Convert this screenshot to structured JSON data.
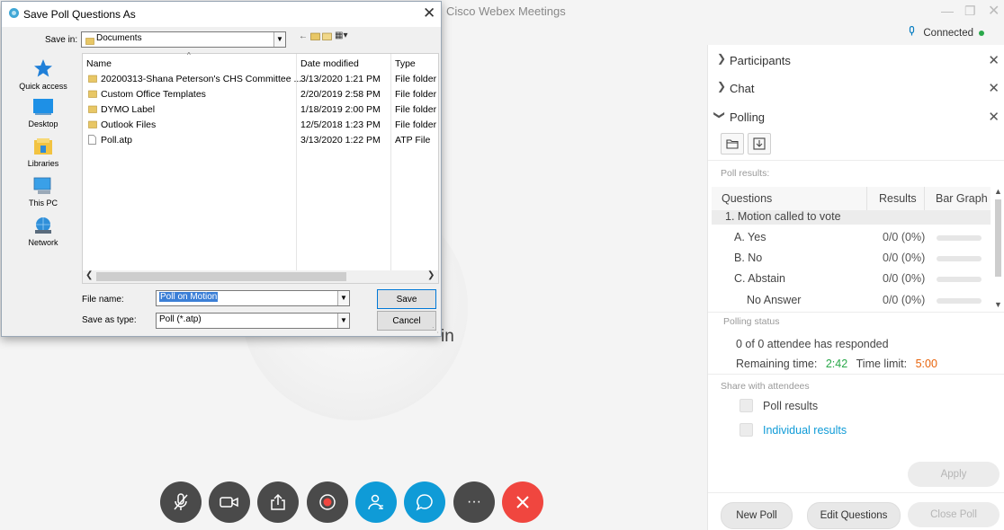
{
  "app": {
    "title": "Cisco Webex Meetings",
    "status": "Connected"
  },
  "meeting": {
    "name_fragment": "in",
    "controls": [
      "mute",
      "video",
      "share",
      "record",
      "participants",
      "chat",
      "more",
      "leave"
    ],
    "more_label": "···"
  },
  "panel": {
    "sections": {
      "participants": "Participants",
      "chat": "Chat",
      "polling": "Polling"
    },
    "poll_results_label": "Poll results:",
    "table": {
      "col_questions": "Questions",
      "col_results": "Results",
      "col_bar": "Bar Graph",
      "question": "1.  Motion called to vote",
      "answers": [
        {
          "label": "A.   Yes",
          "result": "0/0 (0%)",
          "fill": 0
        },
        {
          "label": "B.   No",
          "result": "0/0 (0%)",
          "fill": 0
        },
        {
          "label": "C.   Abstain",
          "result": "0/0 (0%)",
          "fill": 0
        },
        {
          "label": "No Answer",
          "result": "0/0 (0%)",
          "fill": 0
        }
      ]
    },
    "polling_status_label": "Polling status",
    "responded": "0   of   0   attendee has responded",
    "remaining_label": "Remaining time:",
    "remaining_value": "2:42",
    "limit_label": "Time limit:",
    "limit_value": "5:00",
    "share_label": "Share with attendees",
    "share_poll_results": "Poll results",
    "share_individual": "Individual results",
    "apply": "Apply",
    "new_poll": "New Poll",
    "edit_questions": "Edit Questions",
    "close_poll": "Close Poll",
    "colors": {
      "accent": "#0f9bd7",
      "remaining": "#2aa84a",
      "limit": "#e8630a",
      "leave": "#f0463f"
    }
  },
  "dialog": {
    "title": "Save Poll Questions As",
    "save_in_label": "Save in:",
    "save_in_value": "Documents",
    "places": [
      "Quick access",
      "Desktop",
      "Libraries",
      "This PC",
      "Network"
    ],
    "columns": {
      "name": "Name",
      "date": "Date modified",
      "type": "Type"
    },
    "files": [
      {
        "name": "20200313-Shana Peterson's CHS Committee ...",
        "date": "3/13/2020 1:21 PM",
        "type": "File folder",
        "kind": "folder"
      },
      {
        "name": "Custom Office Templates",
        "date": "2/20/2019 2:58 PM",
        "type": "File folder",
        "kind": "folder"
      },
      {
        "name": "DYMO Label",
        "date": "1/18/2019 2:00 PM",
        "type": "File folder",
        "kind": "folder"
      },
      {
        "name": "Outlook Files",
        "date": "12/5/2018 1:23 PM",
        "type": "File folder",
        "kind": "folder"
      },
      {
        "name": "Poll.atp",
        "date": "3/13/2020 1:22 PM",
        "type": "ATP File",
        "kind": "file"
      }
    ],
    "file_name_label": "File name:",
    "file_name_value": "Poll on Motion",
    "save_type_label": "Save as type:",
    "save_type_value": "Poll (*.atp)",
    "save_button": "Save",
    "cancel_button": "Cancel"
  }
}
